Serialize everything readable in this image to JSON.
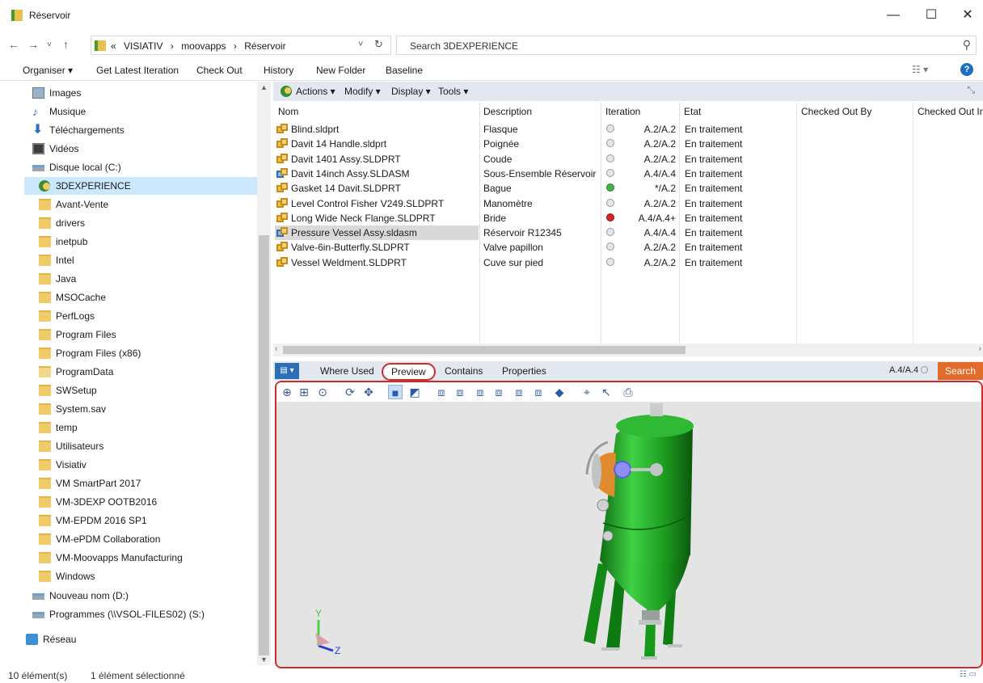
{
  "window": {
    "title": "Réservoir",
    "minimize_glyph": "—",
    "maximize_glyph": "☐",
    "close_glyph": "✕"
  },
  "address": {
    "breadcrumbs": [
      "«",
      "VISIATIV",
      "›",
      "moovapps",
      "›",
      "Réservoir"
    ],
    "search_placeholder": "Search 3DEXPERIENCE"
  },
  "commandbar": {
    "organise": "Organiser ▾",
    "get_latest": "Get Latest Iteration",
    "check_out": "Check Out",
    "history": "History",
    "new_folder": "New Folder",
    "baseline": "Baseline",
    "help": "?"
  },
  "nav": {
    "items": [
      {
        "label": "Images",
        "icon": "image-icon"
      },
      {
        "label": "Musique",
        "icon": "music-icon"
      },
      {
        "label": "Téléchargements",
        "icon": "download-icon"
      },
      {
        "label": "Vidéos",
        "icon": "video-icon"
      },
      {
        "label": "Disque local (C:)",
        "icon": "drive-icon"
      },
      {
        "label": "3DEXPERIENCE",
        "icon": "3dexperience-icon",
        "selected": true
      },
      {
        "label": "Avant-Vente",
        "icon": "folder-icon"
      },
      {
        "label": "drivers",
        "icon": "folder-icon"
      },
      {
        "label": "inetpub",
        "icon": "folder-icon"
      },
      {
        "label": "Intel",
        "icon": "folder-icon"
      },
      {
        "label": "Java",
        "icon": "folder-icon"
      },
      {
        "label": "MSOCache",
        "icon": "folder-icon"
      },
      {
        "label": "PerfLogs",
        "icon": "folder-icon"
      },
      {
        "label": "Program Files",
        "icon": "folder-icon"
      },
      {
        "label": "Program Files (x86)",
        "icon": "folder-icon"
      },
      {
        "label": "ProgramData",
        "icon": "folder-icon"
      },
      {
        "label": "SWSetup",
        "icon": "folder-icon"
      },
      {
        "label": "System.sav",
        "icon": "folder-icon"
      },
      {
        "label": "temp",
        "icon": "folder-icon"
      },
      {
        "label": "Utilisateurs",
        "icon": "folder-icon"
      },
      {
        "label": "Visiativ",
        "icon": "folder-icon"
      },
      {
        "label": "VM SmartPart 2017",
        "icon": "folder-icon"
      },
      {
        "label": "VM-3DEXP OOTB2016",
        "icon": "folder-icon"
      },
      {
        "label": "VM-EPDM 2016 SP1",
        "icon": "folder-icon"
      },
      {
        "label": "VM-ePDM Collaboration",
        "icon": "folder-icon"
      },
      {
        "label": "VM-Moovapps Manufacturing",
        "icon": "folder-icon"
      },
      {
        "label": "Windows",
        "icon": "folder-icon"
      },
      {
        "label": "Nouveau nom (D:)",
        "icon": "drive-icon"
      },
      {
        "label": "Programmes (\\\\VSOL-FILES02) (S:)",
        "icon": "network-drive-icon"
      },
      {
        "label": "Réseau",
        "icon": "network-icon"
      }
    ]
  },
  "exp_toolbar": {
    "actions": "Actions ▾",
    "modify": "Modify ▾",
    "display": "Display ▾",
    "tools": "Tools ▾"
  },
  "filelist": {
    "columns": [
      "Nom",
      "Description",
      "Iteration",
      "Etat",
      "Checked Out By",
      "Checked Out In"
    ],
    "rows": [
      {
        "name": "Blind.sldprt",
        "description": "Flasque",
        "status": "grey",
        "iteration": "A.2/A.2",
        "state": "En traitement",
        "type": "part"
      },
      {
        "name": "Davit 14 Handle.sldprt",
        "description": "Poignée",
        "status": "grey",
        "iteration": "A.2/A.2",
        "state": "En traitement",
        "type": "part"
      },
      {
        "name": "Davit 1401 Assy.SLDPRT",
        "description": "Coude",
        "status": "grey",
        "iteration": "A.2/A.2",
        "state": "En traitement",
        "type": "part"
      },
      {
        "name": "Davit 14inch Assy.SLDASM",
        "description": "Sous-Ensemble Réservoir",
        "status": "grey",
        "iteration": "A.4/A.4",
        "state": "En traitement",
        "type": "assembly"
      },
      {
        "name": "Gasket 14 Davit.SLDPRT",
        "description": "Bague",
        "status": "green",
        "iteration": "*/A.2",
        "state": "En traitement",
        "type": "part"
      },
      {
        "name": "Level Control Fisher V249.SLDPRT",
        "description": "Manomètre",
        "status": "grey",
        "iteration": "A.2/A.2",
        "state": "En traitement",
        "type": "part"
      },
      {
        "name": "Long Wide Neck Flange.SLDPRT",
        "description": "Bride",
        "status": "red",
        "iteration": "A.4/A.4+",
        "state": "En traitement",
        "type": "part"
      },
      {
        "name": "Pressure Vessel Assy.sldasm",
        "description": "Réservoir R12345",
        "status": "grey",
        "iteration": "A.4/A.4",
        "state": "En traitement",
        "type": "assembly",
        "selected": true
      },
      {
        "name": "Valve-6in-Butterfly.SLDPRT",
        "description": "Valve papillon",
        "status": "grey",
        "iteration": "A.2/A.2",
        "state": "En traitement",
        "type": "part"
      },
      {
        "name": "Vessel Weldment.SLDPRT",
        "description": "Cuve sur pied",
        "status": "grey",
        "iteration": "A.2/A.2",
        "state": "En traitement",
        "type": "part"
      }
    ]
  },
  "detail_tabs": {
    "menu": "▤ ▾",
    "where_used": "Where Used",
    "preview": "Preview",
    "contains": "Contains",
    "properties": "Properties",
    "iteration": "A.4/A.4",
    "search": "Search"
  },
  "viewer": {
    "tools": [
      "zoom-in-icon",
      "zoom-area-icon",
      "zoom-fit-icon",
      "rotate-icon",
      "pan-icon",
      "shaded-icon",
      "shaded-edges-icon",
      "iso-view-icon",
      "front-view-icon",
      "back-view-icon",
      "left-view-icon",
      "right-view-icon",
      "top-view-icon",
      "bottom-view-icon",
      "measure-icon",
      "select-icon",
      "print-icon"
    ],
    "axis_y": "Y",
    "axis_z": "Z",
    "model_color": "#1f9a22"
  },
  "status": {
    "count": "10 élément(s)",
    "selection": "1 élément sélectionné"
  }
}
